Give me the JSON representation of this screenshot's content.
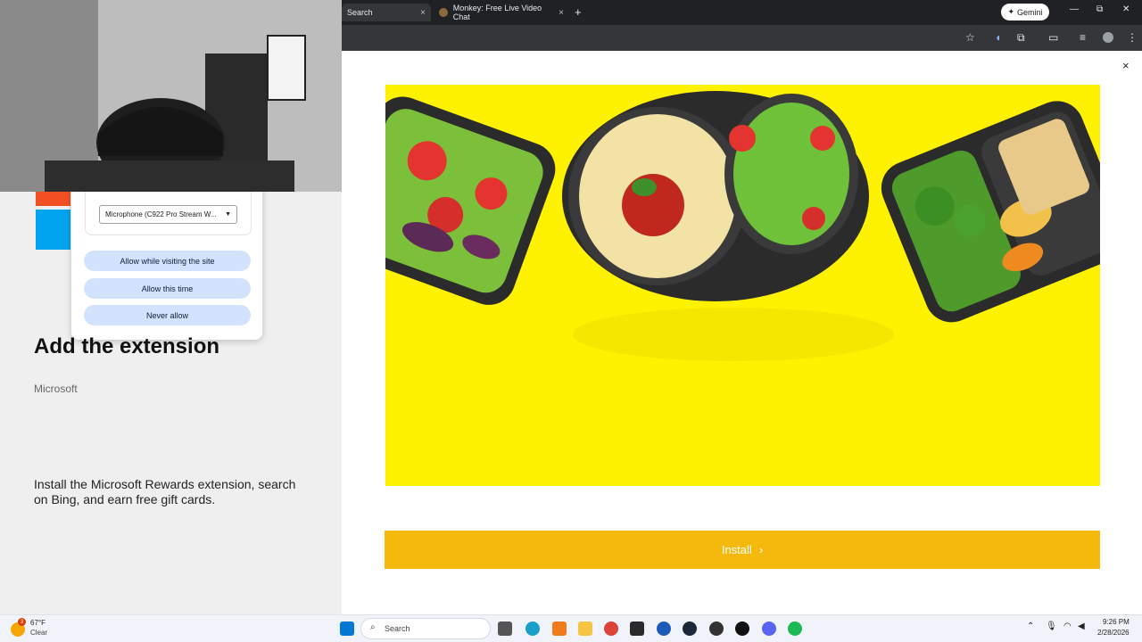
{
  "browser": {
    "tabs": [
      {
        "title": "Search",
        "close": "×"
      },
      {
        "title": "Monkey: Free Live Video Chat",
        "close": "×"
      }
    ],
    "new_tab": "+",
    "gemini_label": "Gemini",
    "window_controls": [
      "—",
      "⧉",
      "✕"
    ]
  },
  "permission_popup": {
    "device_select": "Microphone (C922 Pro Stream W...",
    "buttons": [
      "Allow while visiting the site",
      "Allow this time",
      "Never allow"
    ]
  },
  "extension": {
    "title": "Add the extension",
    "publisher": "Microsoft",
    "description": "Install the Microsoft Rewards extension, search on Bing, and earn free gift cards.",
    "install_label": "Install",
    "brand_colors": {
      "red": "#f25022",
      "blue": "#00a4ef"
    }
  },
  "modal": {
    "close": "×"
  },
  "hero": {
    "background": "#fef200"
  },
  "taskbar": {
    "weather_temp": "67°F",
    "weather_condition": "Clear",
    "weather_badge": "3",
    "search_placeholder": "Search",
    "clock_time": "9:26 PM",
    "clock_date": "2/28/2026",
    "pinned_apps": [
      "start",
      "search",
      "task-view",
      "edge",
      "app",
      "file-explorer",
      "chrome",
      "epic-games",
      "app",
      "steam",
      "app",
      "tiktok",
      "discord",
      "spotify"
    ]
  }
}
